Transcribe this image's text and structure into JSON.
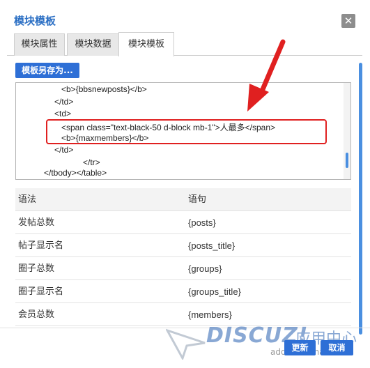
{
  "dialog": {
    "title": "模块模板",
    "close_glyph": "✕"
  },
  "tabs": [
    {
      "label": "模块属性",
      "active": false
    },
    {
      "label": "模块数据",
      "active": false
    },
    {
      "label": "模块模板",
      "active": true
    }
  ],
  "toolbar": {
    "save_as_label": "模板另存为..."
  },
  "code": {
    "lines": [
      "<b>{bbsnewposts}</b>",
      "</td>",
      "<td>",
      "<span class=\"text-black-50 d-block mb-1\">人最多</span>",
      "<b>{maxmembers}</b>",
      "</td>",
      "</tr>",
      "</tbody></table>"
    ]
  },
  "table": {
    "headers": [
      "语法",
      "语句"
    ],
    "rows": [
      [
        "发帖总数",
        "{posts}"
      ],
      [
        "帖子显示名",
        "{posts_title}"
      ],
      [
        "圈子总数",
        "{groups}"
      ],
      [
        "圈子显示名",
        "{groups_title}"
      ],
      [
        "会员总数",
        "{members}"
      ]
    ]
  },
  "footer": {
    "update_label": "更新",
    "cancel_label": "取消"
  },
  "watermark": {
    "logo_text": "DISCUZ!",
    "logo_cn": "应用中心",
    "url": "addon.dismall.com"
  },
  "colors": {
    "accent": "#2e6fd6",
    "highlight": "#e02020",
    "title": "#2b6fc4"
  }
}
